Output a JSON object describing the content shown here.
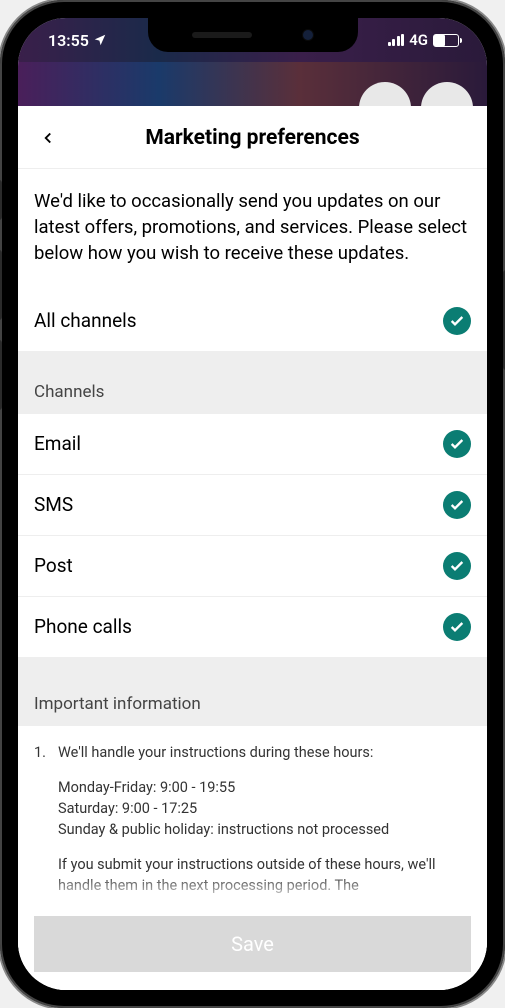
{
  "status": {
    "time": "13:55",
    "network": "4G"
  },
  "header": {
    "title": "Marketing preferences"
  },
  "intro": "We'd like to occasionally send you updates on our latest offers, promotions, and services. Please select below how you wish to receive these updates.",
  "allChannels": {
    "label": "All channels",
    "checked": true
  },
  "channelsSection": {
    "title": "Channels"
  },
  "channels": [
    {
      "label": "Email",
      "checked": true
    },
    {
      "label": "SMS",
      "checked": true
    },
    {
      "label": "Post",
      "checked": true
    },
    {
      "label": "Phone calls",
      "checked": true
    }
  ],
  "importantSection": {
    "title": "Important information"
  },
  "info": {
    "num": "1.",
    "lead": "We'll handle your instructions during these hours:",
    "hours1": "Monday-Friday: 9:00 - 19:55",
    "hours2": "Saturday: 9:00 - 17:25",
    "hours3": "Sunday & public holiday: instructions not processed",
    "followup": "If you submit your instructions outside of these hours, we'll handle them in the next processing period. The"
  },
  "footer": {
    "save": "Save"
  }
}
